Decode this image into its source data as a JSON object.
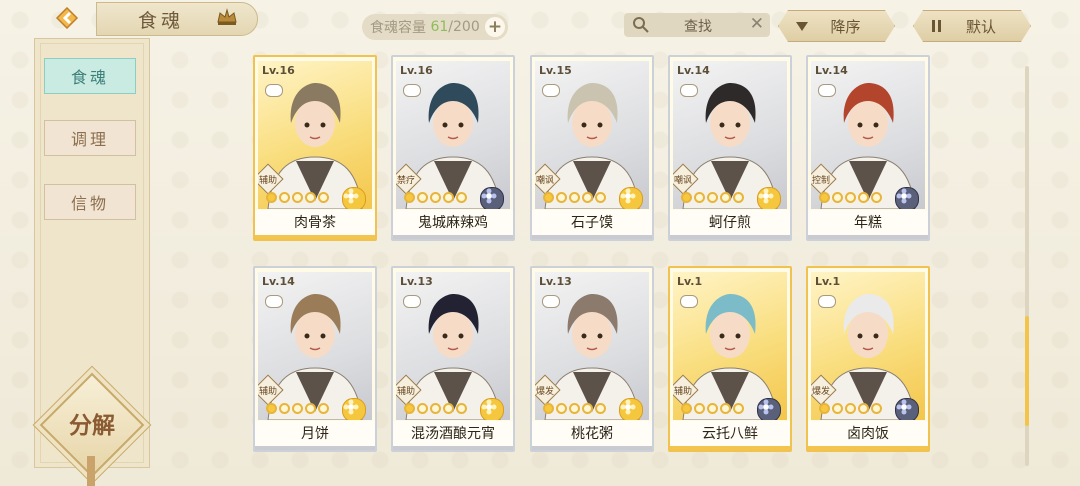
{
  "header": {
    "title": "食魂",
    "capacity_label": "食魂容量",
    "capacity_current": "61",
    "capacity_max": "/200",
    "search_label": "查找",
    "sort_desc_label": "降序",
    "sort_default_label": "默认"
  },
  "sidebar": {
    "items": [
      {
        "label": "食魂"
      },
      {
        "label": "调理"
      },
      {
        "label": "信物"
      }
    ],
    "decompose_label": "分解"
  },
  "cards": [
    {
      "level": "Lv.16",
      "name": "肉骨茶",
      "role": "辅助",
      "element": "gold",
      "frame": "gold"
    },
    {
      "level": "Lv.16",
      "name": "鬼城麻辣鸡",
      "role": "禁疗",
      "element": "dark",
      "frame": "silver"
    },
    {
      "level": "Lv.15",
      "name": "石子馍",
      "role": "嘲讽",
      "element": "gold",
      "frame": "silver"
    },
    {
      "level": "Lv.14",
      "name": "蚵仔煎",
      "role": "嘲讽",
      "element": "gold",
      "frame": "silver"
    },
    {
      "level": "Lv.14",
      "name": "年糕",
      "role": "控制",
      "element": "dark",
      "frame": "silver"
    },
    {
      "level": "Lv.14",
      "name": "月饼",
      "role": "辅助",
      "element": "gold",
      "frame": "silver"
    },
    {
      "level": "Lv.13",
      "name": "混汤酒酿元宵",
      "role": "辅助",
      "element": "gold",
      "frame": "silver"
    },
    {
      "level": "Lv.13",
      "name": "桃花粥",
      "role": "爆发",
      "element": "gold",
      "frame": "silver"
    },
    {
      "level": "Lv.1",
      "name": "云托八鲜",
      "role": "辅助",
      "element": "dark",
      "frame": "gold"
    },
    {
      "level": "Lv.1",
      "name": "卤肉饭",
      "role": "爆发",
      "element": "dark",
      "frame": "gold"
    }
  ]
}
